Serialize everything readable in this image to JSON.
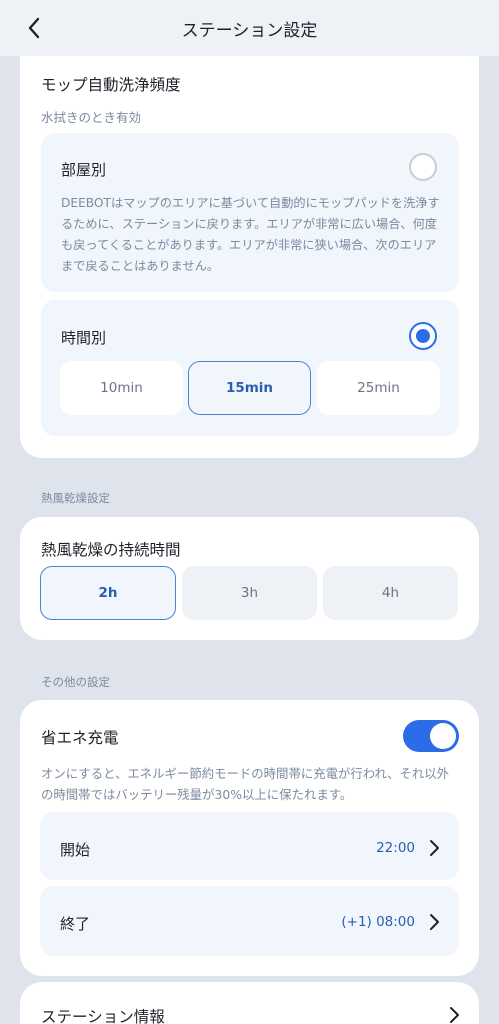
{
  "header": {
    "title": "ステーション設定"
  },
  "mop_wash": {
    "title": "モップ自動洗浄頻度",
    "subtitle": "水拭きのとき有効",
    "by_room": {
      "title": "部屋別",
      "description": "DEEBOTはマップのエリアに基づいて自動的にモップパッドを洗浄するために、ステーションに戻ります。エリアが非常に広い場合、何度も戻ってくることがあります。エリアが非常に狭い場合、次のエリアまで戻ることはありません。",
      "selected": false
    },
    "by_time": {
      "title": "時間別",
      "selected": true,
      "options": [
        "10min",
        "15min",
        "25min"
      ],
      "selected_option": "15min"
    }
  },
  "hot_air": {
    "section_label": "熱風乾燥設定",
    "title": "熱風乾燥の持続時間",
    "options": [
      "2h",
      "3h",
      "4h"
    ],
    "selected_option": "2h"
  },
  "other": {
    "section_label": "その他の設定",
    "eco_charge": {
      "title": "省エネ充電",
      "enabled": true,
      "description": "オンにすると、エネルギー節約モードの時間帯に充電が行われ、それ以外の時間帯ではバッテリー残量が30%以上に保たれます。",
      "start_label": "開始",
      "start_value": "22:00",
      "end_label": "終了",
      "end_value": "(+1) 08:00"
    }
  },
  "station_info": {
    "label": "ステーション情報"
  },
  "colors": {
    "accent": "#2b6de8",
    "background": "#dfe4ec",
    "card": "#ffffff",
    "inner": "#f1f5fc"
  }
}
